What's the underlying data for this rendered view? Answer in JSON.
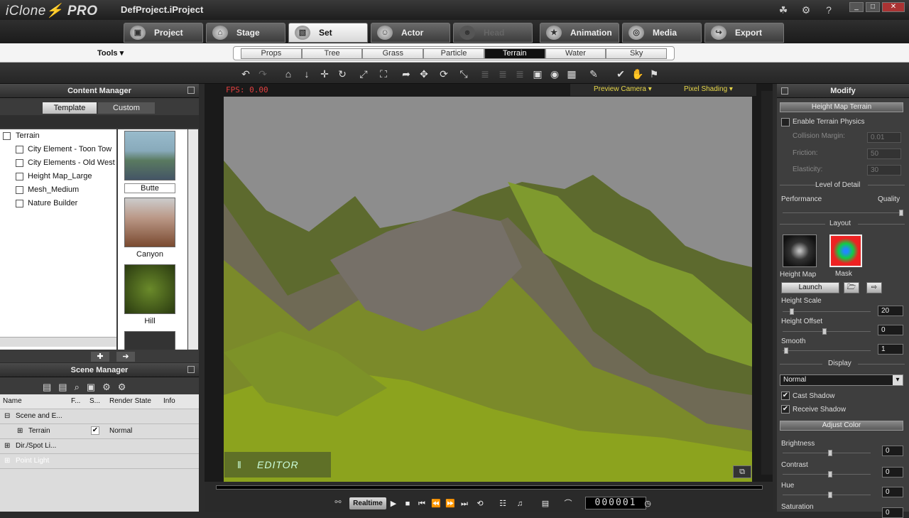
{
  "app": {
    "logo": "iClone",
    "edition": "PRO",
    "project": "DefProject.iProject"
  },
  "main_tabs": [
    {
      "label": "Project",
      "icon": "project-icon"
    },
    {
      "label": "Stage",
      "icon": "stage-icon"
    },
    {
      "label": "Set",
      "icon": "set-icon"
    },
    {
      "label": "Actor",
      "icon": "actor-icon"
    },
    {
      "label": "Head",
      "icon": "head-icon"
    },
    {
      "label": "Animation",
      "icon": "animation-icon"
    },
    {
      "label": "Media",
      "icon": "media-icon"
    },
    {
      "label": "Export",
      "icon": "export-icon"
    }
  ],
  "tools_label": "Tools",
  "sub_tabs": [
    "Props",
    "Tree",
    "Grass",
    "Particle",
    "Terrain",
    "Water",
    "Sky"
  ],
  "content_manager": {
    "title": "Content Manager",
    "tabs": [
      "Template",
      "Custom"
    ],
    "tree": {
      "root": "Terrain",
      "children": [
        "City Element - Toon Tow",
        "City Elements - Old West",
        "Height Map_Large",
        "Mesh_Medium",
        "Nature Builder"
      ]
    },
    "thumbnails": [
      "Butte",
      "Canyon",
      "Hill"
    ]
  },
  "scene_manager": {
    "title": "Scene Manager",
    "columns": [
      "Name",
      "F...",
      "S...",
      "Render State",
      "Info"
    ],
    "rows": [
      {
        "name": "Scene and E...",
        "render": ""
      },
      {
        "name": "Terrain",
        "render": "Normal"
      },
      {
        "name": "Dir./Spot Li...",
        "render": ""
      },
      {
        "name": "Point Light",
        "render": ""
      }
    ]
  },
  "viewport": {
    "fps": "FPS: 0.00",
    "camera": "Preview Camera",
    "shading": "Pixel Shading",
    "mode": "EDITOR MODE"
  },
  "timeline": {
    "realtime": "Realtime",
    "frame": "000001"
  },
  "modify": {
    "title": "Modify",
    "section_terrain": "Height Map Terrain",
    "enable_physics": "Enable Terrain Physics",
    "collision_margin": {
      "label": "Collision Margin:",
      "value": "0.01"
    },
    "friction": {
      "label": "Friction:",
      "value": "50"
    },
    "elasticity": {
      "label": "Elasticity:",
      "value": "30"
    },
    "lod_title": "Level of Detail",
    "performance": "Performance",
    "quality": "Quality",
    "layout_title": "Layout",
    "height_map": "Height Map",
    "mask": "Mask",
    "launch": "Launch",
    "height_scale": {
      "label": "Height Scale",
      "value": "20"
    },
    "height_offset": {
      "label": "Height Offset",
      "value": "0"
    },
    "smooth": {
      "label": "Smooth",
      "value": "1"
    },
    "display_title": "Display",
    "display_value": "Normal",
    "cast_shadow": "Cast Shadow",
    "receive_shadow": "Receive Shadow",
    "adjust_color": "Adjust Color",
    "brightness": {
      "label": "Brightness",
      "value": "0"
    },
    "contrast": {
      "label": "Contrast",
      "value": "0"
    },
    "hue": {
      "label": "Hue",
      "value": "0"
    },
    "saturation": {
      "label": "Saturation",
      "value": "0"
    }
  }
}
